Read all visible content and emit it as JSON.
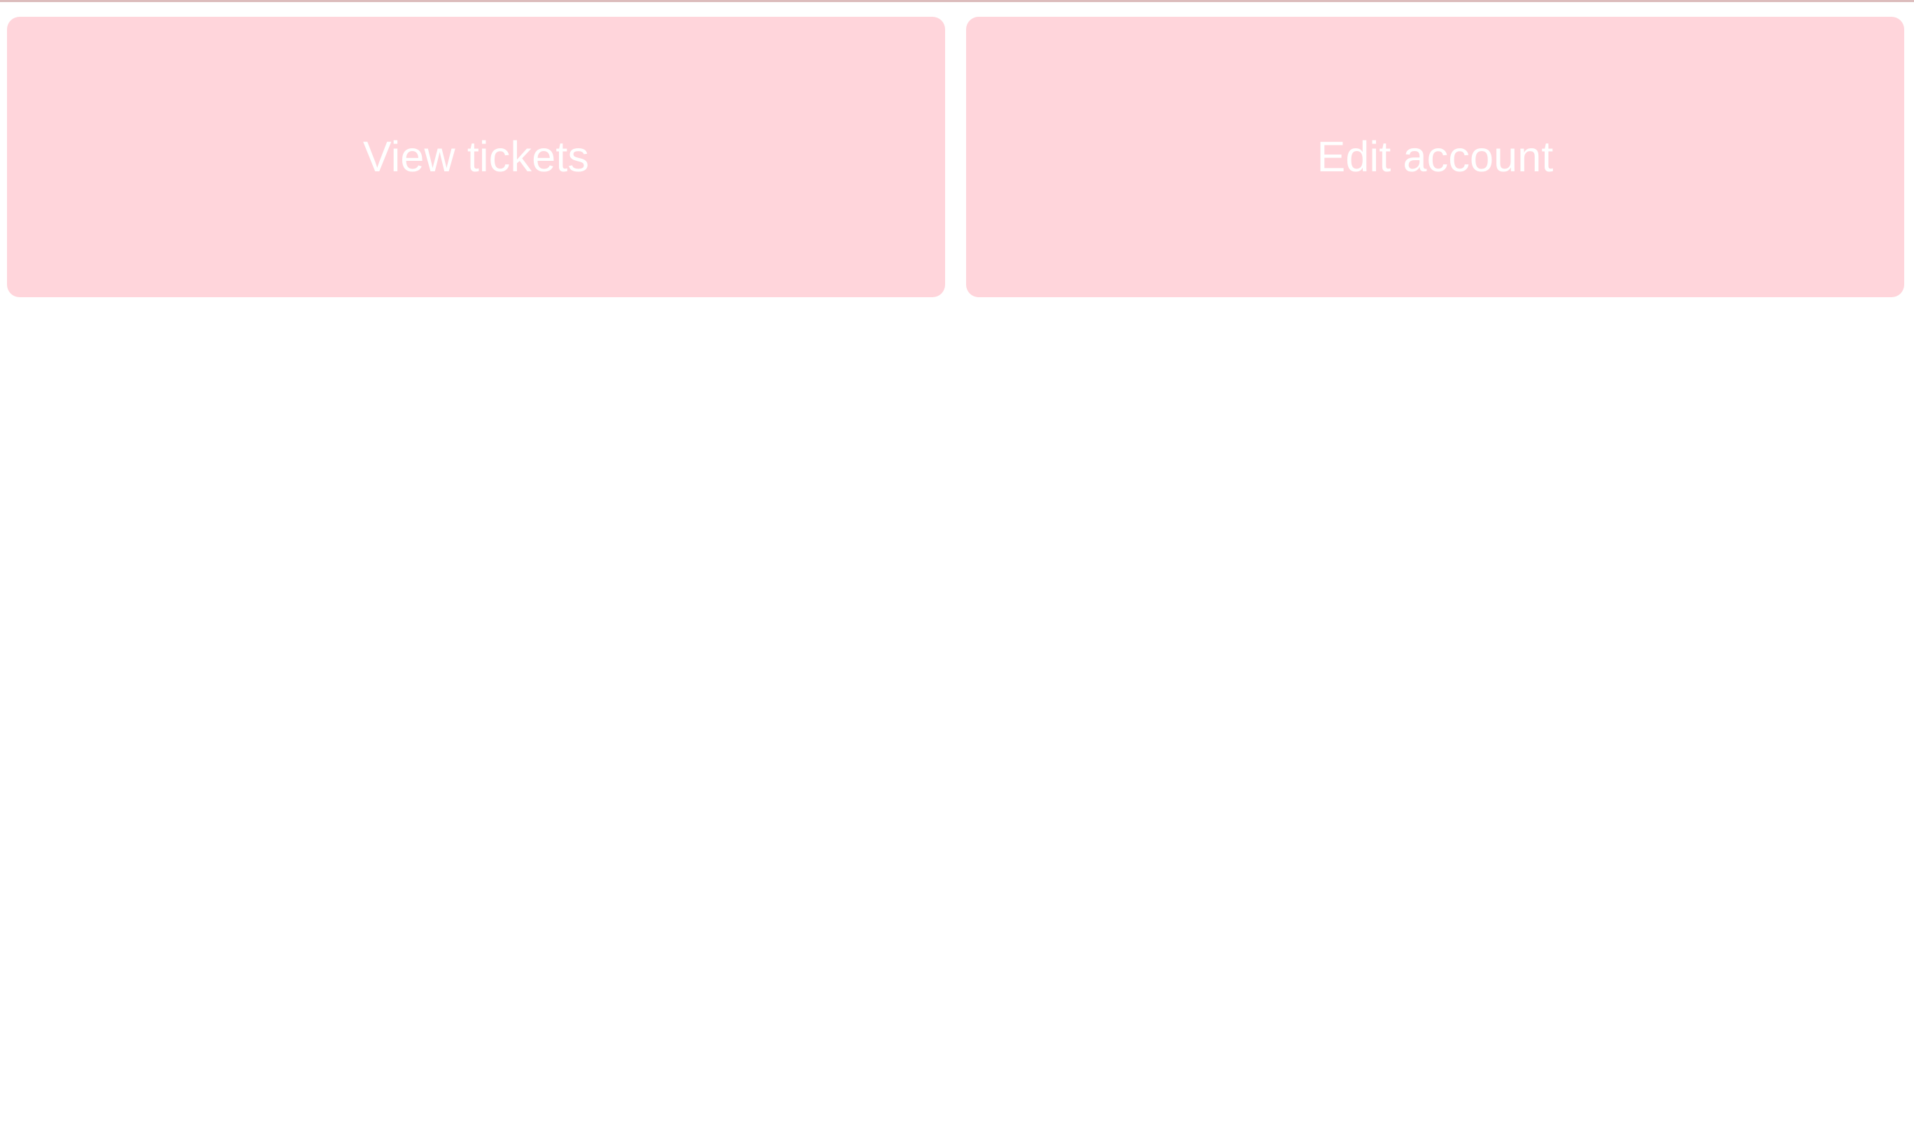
{
  "colors": {
    "tile_background": "#ffd5db",
    "tile_text": "#ffffff",
    "top_rule": "#dcbcbc",
    "page_background": "#ffffff"
  },
  "tiles": [
    {
      "label": "View tickets"
    },
    {
      "label": "Edit account"
    }
  ]
}
